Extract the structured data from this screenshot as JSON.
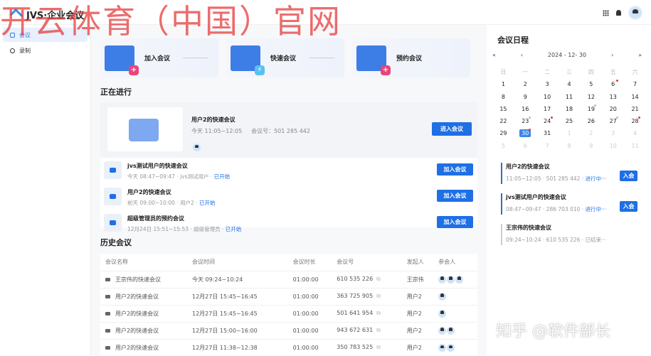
{
  "app": {
    "title": "JVS·企业会议"
  },
  "sidebar": {
    "items": [
      {
        "label": "会议",
        "active": true
      },
      {
        "label": "录制"
      }
    ]
  },
  "cards": [
    {
      "label": "加入会议",
      "icon": "plus-icon",
      "color": "#e8467a"
    },
    {
      "label": "快速会议",
      "icon": "bolt-icon",
      "color": "#5bc0f0"
    },
    {
      "label": "预约会议",
      "icon": "plus-icon",
      "color": "#e8467a"
    }
  ],
  "ongoing": {
    "title": "正在进行",
    "hero": {
      "name": "用户2的快速会议",
      "time": "今天 11:05~12:05",
      "id": "会议号：501 285 442",
      "button": "进入会议"
    },
    "items": [
      {
        "name": "jvs测试用户的快速会议",
        "time": "今天 08:47~09:47",
        "host": "jvs测试用户",
        "status": "已开始",
        "button": "加入会议"
      },
      {
        "name": "用户2的快速会议",
        "time": "前天 09:00~10:00",
        "host": "用户2",
        "status": "已开始",
        "button": "加入会议"
      },
      {
        "name": "超级管理员的预约会议",
        "time": "12月24日 15:51~15:53",
        "host": "超级管理员",
        "status": "已开始",
        "button": "加入会议"
      }
    ]
  },
  "history": {
    "title": "历史会议",
    "columns": [
      "会议名称",
      "会议时间",
      "会议时长",
      "会议号",
      "发起人",
      "参会人"
    ],
    "rows": [
      {
        "name": "王宗伟的快速会议",
        "time": "今天 09:24~10:24",
        "duration": "01:00:00",
        "id": "610 535 226",
        "host": "王宗伟",
        "attendees": 3
      },
      {
        "name": "用户2的快速会议",
        "time": "12月27日 15:45~16:45",
        "duration": "01:00:00",
        "id": "363 725 905",
        "host": "用户2",
        "attendees": 1
      },
      {
        "name": "用户2的快速会议",
        "time": "12月27日 15:45~16:45",
        "duration": "01:00:00",
        "id": "501 641 954",
        "host": "用户2",
        "attendees": 1
      },
      {
        "name": "用户2的快速会议",
        "time": "12月27日 15:00~16:00",
        "duration": "01:00:00",
        "id": "943 672 631",
        "host": "用户2",
        "attendees": 2
      },
      {
        "name": "用户2的快速会议",
        "time": "12月27日 11:38~12:38",
        "duration": "01:00:00",
        "id": "350 783 525",
        "host": "用户2",
        "attendees": 2
      }
    ]
  },
  "schedule": {
    "title": "会议日程",
    "date": "2024 - 12- 30",
    "weekdays": [
      "日",
      "一",
      "二",
      "三",
      "四",
      "五",
      "六"
    ],
    "red_dots": [
      6,
      24,
      28,
      30
    ],
    "grey_dots": [
      19,
      23,
      27
    ],
    "selected": 30,
    "items": [
      {
        "name": "用户2的快速会议",
        "time": "11:05~12:05",
        "id": "501 285 442",
        "status": "进行中···",
        "button": "入会"
      },
      {
        "name": "jvs测试用户的快速会议",
        "time": "08:47~09:47",
        "id": "286 703 010",
        "status": "进行中···",
        "button": "入会"
      },
      {
        "name": "王宗伟的快速会议",
        "time": "09:24~10:24",
        "id": "610 535 226",
        "status": "已结束···"
      }
    ]
  },
  "watermarks": {
    "overlay": "开云体育（中国）官网",
    "corner": "知乎 @软件部长"
  }
}
